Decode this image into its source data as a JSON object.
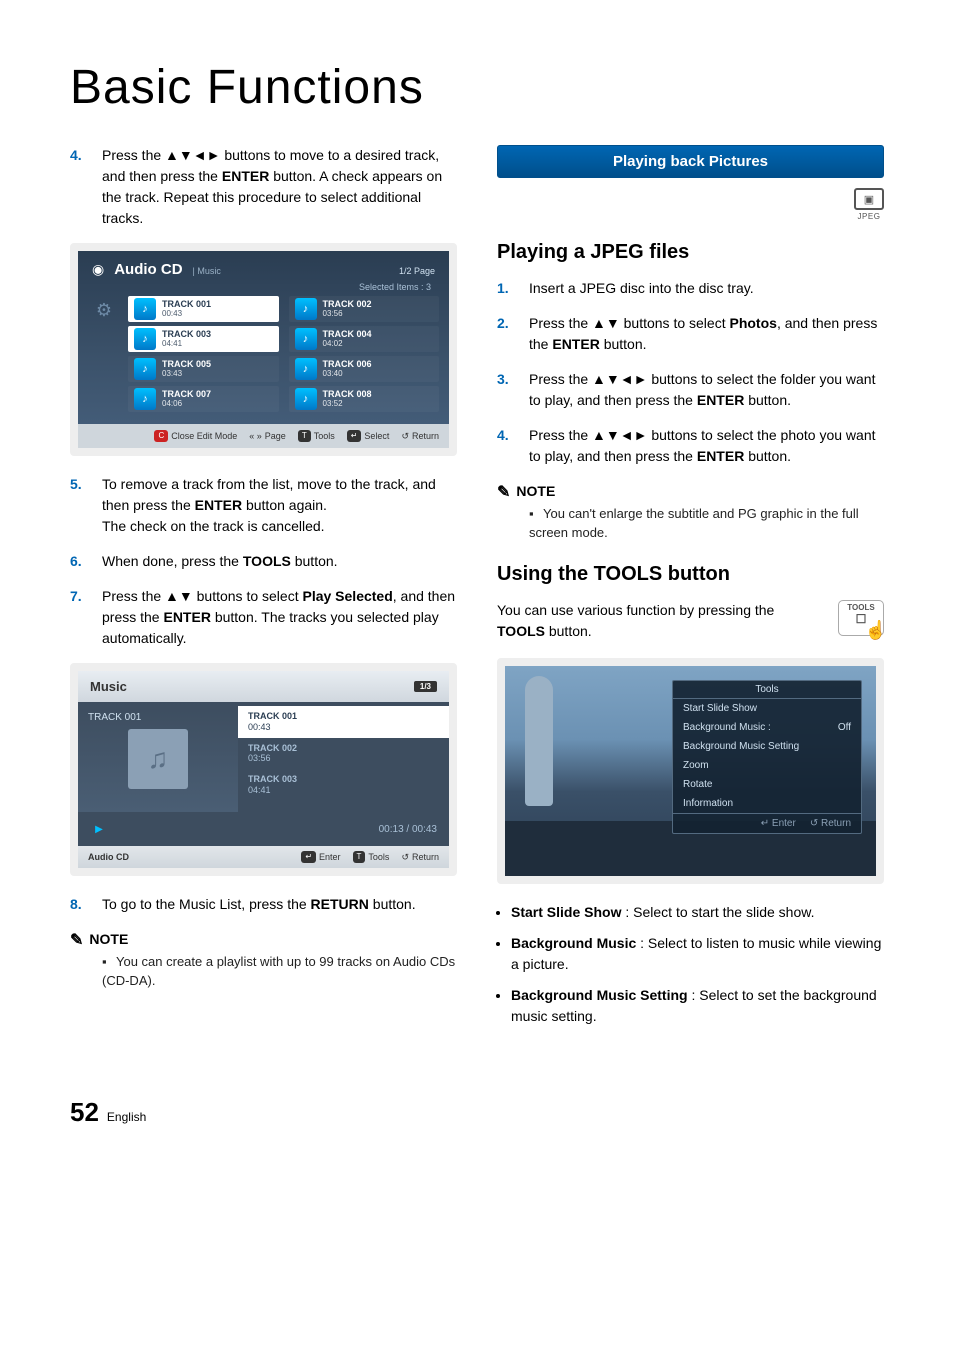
{
  "page_title": "Basic Functions",
  "left": {
    "steps": {
      "4": {
        "text_a": "Press the ▲▼◄► buttons to move to a desired track, and then press the ",
        "enter": "ENTER",
        "text_b": " button. A check appears on the track. Repeat this procedure to select additional tracks."
      },
      "5": {
        "text_a": "To remove a track from the list, move to the track, and then press the ",
        "enter": "ENTER",
        "text_b": " button again.",
        "text_c": "The check on the track is cancelled."
      },
      "6": {
        "text_a": "When done, press the ",
        "tools": "TOOLS",
        "text_b": " button."
      },
      "7": {
        "text_a": "Press the ▲▼ buttons to select ",
        "play_sel": "Play Selected",
        "text_b": ", and then press the ",
        "enter": "ENTER",
        "text_c": " button. The tracks you selected play automatically."
      },
      "8": {
        "text_a": "To go to the Music List, press the ",
        "return": "RETURN",
        "text_b": " button."
      }
    },
    "audio": {
      "title": "Audio CD",
      "sub": "| Music",
      "page": "1/2 Page",
      "selected": "Selected Items : 3",
      "tracks": [
        {
          "name": "TRACK 001",
          "dur": "00:43",
          "sel": true
        },
        {
          "name": "TRACK 002",
          "dur": "03:56",
          "sel": false
        },
        {
          "name": "TRACK 003",
          "dur": "04:41",
          "sel": true
        },
        {
          "name": "TRACK 004",
          "dur": "04:02",
          "sel": false
        },
        {
          "name": "TRACK 005",
          "dur": "03:43",
          "sel": false
        },
        {
          "name": "TRACK 006",
          "dur": "03:40",
          "sel": false
        },
        {
          "name": "TRACK 007",
          "dur": "04:06",
          "sel": false
        },
        {
          "name": "TRACK 008",
          "dur": "03:52",
          "sel": false
        }
      ],
      "foot": {
        "close": "Close Edit Mode",
        "page_nav": "Page",
        "tools": "Tools",
        "select": "Select",
        "return": "Return"
      }
    },
    "music": {
      "title": "Music",
      "page": "1/3",
      "now": "TRACK 001",
      "list": [
        {
          "name": "TRACK 001",
          "dur": "00:43",
          "cur": true
        },
        {
          "name": "TRACK 002",
          "dur": "03:56",
          "cur": false
        },
        {
          "name": "TRACK 003",
          "dur": "04:41",
          "cur": false
        }
      ],
      "time": "00:13 / 00:43",
      "foot": {
        "src": "Audio CD",
        "enter": "Enter",
        "tools": "Tools",
        "return": "Return"
      }
    },
    "note_label": "NOTE",
    "note_text": "You can create a playlist with up to 99 tracks on Audio CDs (CD-DA)."
  },
  "right": {
    "blue_bar": "Playing back Pictures",
    "jpeg_label": "JPEG",
    "h_play": "Playing a JPEG files",
    "steps": {
      "1": {
        "text": "Insert a JPEG disc into the disc tray."
      },
      "2": {
        "text_a": "Press the ▲▼ buttons to select ",
        "photos": "Photos",
        "text_b": ", and then press the ",
        "enter": "ENTER",
        "text_c": " button."
      },
      "3": {
        "text_a": "Press the ▲▼◄► buttons to select the folder you want to play, and then press the ",
        "enter": "ENTER",
        "text_b": " button."
      },
      "4": {
        "text_a": "Press the ▲▼◄► buttons to select the photo you want to play, and then press the ",
        "enter": "ENTER",
        "text_b": " button."
      }
    },
    "note_label": "NOTE",
    "note_text": "You can't enlarge the subtitle and PG graphic in the full screen mode.",
    "h_tools": "Using the TOOLS button",
    "tools_para_a": "You can use various function by pressing the ",
    "tools_word": "TOOLS",
    "tools_para_b": " button.",
    "tools_badge": "TOOLS",
    "tools_menu": {
      "title": "Tools",
      "rows": [
        {
          "l": "Start Slide Show",
          "v": ""
        },
        {
          "l": "Background Music   :",
          "v": "Off"
        },
        {
          "l": "Background Music Setting",
          "v": ""
        },
        {
          "l": "Zoom",
          "v": ""
        },
        {
          "l": "Rotate",
          "v": ""
        },
        {
          "l": "Information",
          "v": ""
        }
      ],
      "foot": {
        "enter": "Enter",
        "return": "Return"
      }
    },
    "bullets": [
      {
        "b": "Start Slide Show",
        "t": " : Select to start the slide show."
      },
      {
        "b": "Background Music",
        "t": " : Select to listen to music while viewing a picture."
      },
      {
        "b": "Background Music Setting",
        "t": " : Select to set the background music setting."
      }
    ]
  },
  "footer": {
    "page": "52",
    "lang": "English"
  }
}
